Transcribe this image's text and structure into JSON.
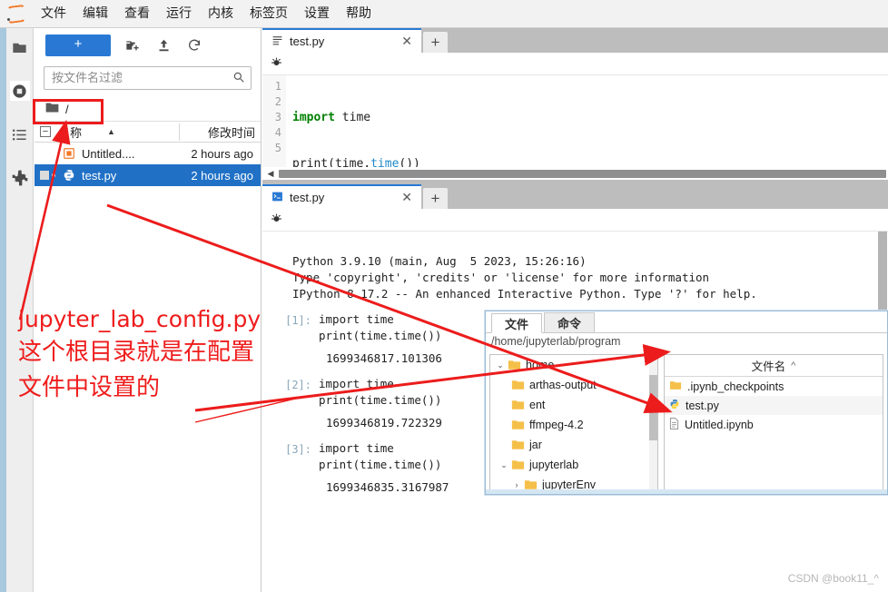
{
  "app": {
    "logo": "jupyter-logo",
    "menus": [
      "文件",
      "编辑",
      "查看",
      "运行",
      "内核",
      "标签页",
      "设置",
      "帮助"
    ]
  },
  "activitybar": {
    "items": [
      {
        "name": "file-browser",
        "icon": "folder-icon"
      },
      {
        "name": "running-sessions",
        "icon": "stop-circle-icon"
      },
      {
        "name": "commands",
        "icon": "list-icon"
      },
      {
        "name": "extensions",
        "icon": "puzzle-icon"
      }
    ]
  },
  "filebrowser": {
    "new_button_label": "+",
    "toolbar_icons": [
      "new-folder-icon",
      "upload-icon",
      "refresh-icon"
    ],
    "filter_placeholder": "按文件名过滤",
    "filter_value": "",
    "search_icon": "search-icon",
    "breadcrumb": "/",
    "columns": {
      "name": "名称",
      "modified": "修改时间"
    },
    "sort_caret": "▲",
    "rows": [
      {
        "name": "Untitled....",
        "modified": "2 hours ago",
        "icon": "notebook-icon",
        "selected": false
      },
      {
        "name": "test.py",
        "modified": "2 hours ago",
        "icon": "python-icon",
        "selected": true
      }
    ]
  },
  "editor": {
    "tab_label": "test.py",
    "tab_icon": "text-file-icon",
    "close_label": "✕",
    "add_tab_label": "+",
    "toolbar_icon": "debug-bug-icon",
    "line_numbers": [
      "1",
      "2",
      "3",
      "4",
      "5"
    ],
    "code_lines": [
      {
        "parts": [
          {
            "t": "import",
            "c": "kw"
          },
          {
            "t": " time",
            "c": ""
          }
        ]
      },
      {
        "parts": [
          {
            "t": "print(time.",
            "c": ""
          },
          {
            "t": "time",
            "c": "fn"
          },
          {
            "t": "())",
            "c": ""
          }
        ]
      }
    ]
  },
  "console": {
    "tab_label": "test.py",
    "tab_icon": "console-icon",
    "close_label": "✕",
    "add_tab_label": "+",
    "toolbar_icon": "debug-bug-icon",
    "banner": "Python 3.9.10 (main, Aug  5 2023, 15:26:16)\nType 'copyright', 'credits' or 'license' for more information\nIPython 8.17.2 -- An enhanced Interactive Python. Type '?' for help.",
    "cells": [
      {
        "prompt": "[1]:",
        "code": "import time\nprint(time.time())",
        "output": "1699346817.101306"
      },
      {
        "prompt": "[2]:",
        "code": "import time\nprint(time.time())",
        "output": "1699346819.722329"
      },
      {
        "prompt": "[3]:",
        "code": "import time\nprint(time.time())",
        "output": "1699346835.3167987"
      }
    ]
  },
  "dialog": {
    "tabs": [
      {
        "label": "文件",
        "active": true
      },
      {
        "label": "命令",
        "active": false
      }
    ],
    "path": "/home/jupyterlab/program",
    "tree": [
      {
        "label": "home",
        "depth": 0,
        "twisty": "⌄"
      },
      {
        "label": "arthas-output",
        "depth": 1,
        "twisty": ""
      },
      {
        "label": "ent",
        "depth": 1,
        "twisty": ""
      },
      {
        "label": "ffmpeg-4.2",
        "depth": 1,
        "twisty": ""
      },
      {
        "label": "jar",
        "depth": 1,
        "twisty": ""
      },
      {
        "label": "jupyterlab",
        "depth": 1,
        "twisty": "⌄"
      },
      {
        "label": "jupyterEnv",
        "depth": 2,
        "twisty": "›"
      }
    ],
    "list_header": "文件名",
    "list_sort_caret": "^",
    "files": [
      {
        "name": ".ipynb_checkpoints",
        "icon": "folder-icon",
        "highlight": false
      },
      {
        "name": "test.py",
        "icon": "python-icon",
        "highlight": true
      },
      {
        "name": "Untitled.ipynb",
        "icon": "notebook-file-icon",
        "highlight": false
      }
    ]
  },
  "annotations": {
    "color": "#ef1c1c",
    "title": "jupyter_lab_config.py",
    "line1": "这个根目录就是在配置",
    "line2": "文件中设置的"
  },
  "watermark": "CSDN @book11_^"
}
